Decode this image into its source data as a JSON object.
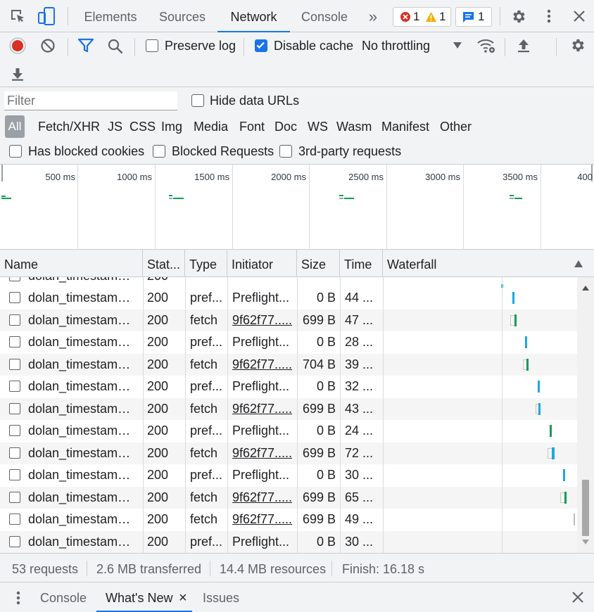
{
  "tabs": [
    {
      "label": "Elements",
      "active": false
    },
    {
      "label": "Sources",
      "active": false
    },
    {
      "label": "Network",
      "active": true
    },
    {
      "label": "Console",
      "active": false
    }
  ],
  "more_tabs": "»",
  "badges": {
    "errors": "1",
    "warnings": "1",
    "messages": "1"
  },
  "toolbar": {
    "preserve_log": "Preserve log",
    "disable_cache": "Disable cache",
    "throttling": "No throttling"
  },
  "filter": {
    "placeholder": "Filter",
    "hide_data_urls": "Hide data URLs",
    "types": [
      "All",
      "Fetch/XHR",
      "JS",
      "CSS",
      "Img",
      "Media",
      "Font",
      "Doc",
      "WS",
      "Wasm",
      "Manifest",
      "Other"
    ],
    "has_blocked_cookies": "Has blocked cookies",
    "blocked_requests": "Blocked Requests",
    "third_party": "3rd-party requests"
  },
  "overview": {
    "ticks": [
      "500 ms",
      "1000 ms",
      "1500 ms",
      "2000 ms",
      "2500 ms",
      "3000 ms",
      "3500 ms",
      "400"
    ]
  },
  "columns": {
    "name": "Name",
    "status": "Stat...",
    "type": "Type",
    "initiator": "Initiator",
    "size": "Size",
    "time": "Time",
    "waterfall": "Waterfall"
  },
  "rows": [
    {
      "name": "dolan_timestamp....",
      "status": "200",
      "type": "pref...",
      "initiator": "Preflight...",
      "size": "0 B",
      "time": "44 ...",
      "link": false
    },
    {
      "name": "dolan_timestamp....",
      "status": "200",
      "type": "fetch",
      "initiator": "9f62f77.....",
      "size": "699 B",
      "time": "47 ...",
      "link": true
    },
    {
      "name": "dolan_timestamp....",
      "status": "200",
      "type": "pref...",
      "initiator": "Preflight...",
      "size": "0 B",
      "time": "28 ...",
      "link": false
    },
    {
      "name": "dolan_timestamp....",
      "status": "200",
      "type": "fetch",
      "initiator": "9f62f77.....",
      "size": "704 B",
      "time": "39 ...",
      "link": true
    },
    {
      "name": "dolan_timestamp....",
      "status": "200",
      "type": "pref...",
      "initiator": "Preflight...",
      "size": "0 B",
      "time": "32 ...",
      "link": false
    },
    {
      "name": "dolan_timestamp....",
      "status": "200",
      "type": "fetch",
      "initiator": "9f62f77.....",
      "size": "699 B",
      "time": "43 ...",
      "link": true
    },
    {
      "name": "dolan_timestamp....",
      "status": "200",
      "type": "pref...",
      "initiator": "Preflight...",
      "size": "0 B",
      "time": "24 ...",
      "link": false
    },
    {
      "name": "dolan_timestamp....",
      "status": "200",
      "type": "fetch",
      "initiator": "9f62f77.....",
      "size": "699 B",
      "time": "72 ...",
      "link": true
    },
    {
      "name": "dolan_timestamp....",
      "status": "200",
      "type": "pref...",
      "initiator": "Preflight...",
      "size": "0 B",
      "time": "30 ...",
      "link": false
    },
    {
      "name": "dolan_timestamp....",
      "status": "200",
      "type": "fetch",
      "initiator": "9f62f77.....",
      "size": "699 B",
      "time": "65 ...",
      "link": true
    },
    {
      "name": "dolan_timestamp....",
      "status": "200",
      "type": "fetch",
      "initiator": "9f62f77.....",
      "size": "699 B",
      "time": "49 ...",
      "link": true
    },
    {
      "name": "dolan_timestamp....",
      "status": "200",
      "type": "pref...",
      "initiator": "Preflight...",
      "size": "0 B",
      "time": "30 ...",
      "link": false
    }
  ],
  "status_bar": {
    "requests": "53 requests",
    "transferred": "2.6 MB transferred",
    "resources": "14.4 MB resources",
    "finish": "Finish: 16.18 s"
  },
  "drawer": {
    "tabs": [
      "Console",
      "What's New",
      "Issues"
    ],
    "close_tab": "×"
  },
  "colors": {
    "accent": "#1a73e8",
    "record": "#d93025",
    "waterfall_blue": "#1ea7e1",
    "waterfall_green": "#0f9d58"
  }
}
